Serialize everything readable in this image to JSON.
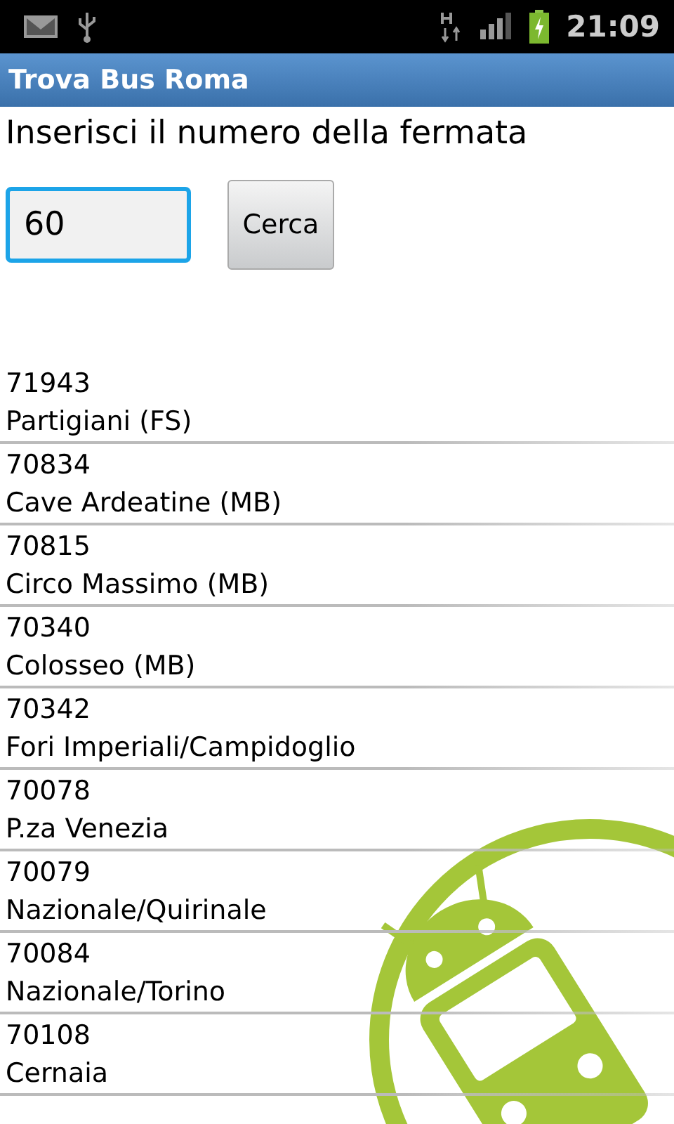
{
  "status_bar": {
    "time": "21:09"
  },
  "app_bar": {
    "title": "Trova Bus Roma"
  },
  "prompt": "Inserisci il numero della fermata",
  "search": {
    "value": "60",
    "focused": true,
    "button": "Cerca"
  },
  "stops": [
    {
      "code": "71943",
      "name": "Partigiani (FS)"
    },
    {
      "code": "70834",
      "name": "Cave Ardeatine (MB)"
    },
    {
      "code": "70815",
      "name": "Circo Massimo (MB)"
    },
    {
      "code": "70340",
      "name": "Colosseo (MB)"
    },
    {
      "code": "70342",
      "name": "Fori Imperiali/Campidoglio"
    },
    {
      "code": "70078",
      "name": "P.za Venezia"
    },
    {
      "code": "70079",
      "name": "Nazionale/Quirinale"
    },
    {
      "code": "70084",
      "name": "Nazionale/Torino"
    },
    {
      "code": "70108",
      "name": "Cernaia"
    }
  ]
}
